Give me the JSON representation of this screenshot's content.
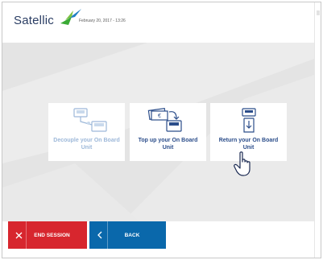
{
  "header": {
    "brand": "Satellic",
    "datetime": "February 20, 2017 - 13:26",
    "logo_icon": "satellic-logo-icon"
  },
  "options": [
    {
      "label": "Decouple your On Board Unit",
      "icon": "decouple-obu-icon",
      "state": "disabled"
    },
    {
      "label": "Top up your On Board Unit",
      "icon": "top-up-obu-icon",
      "state": "enabled"
    },
    {
      "label": "Return your On Board Unit",
      "icon": "return-obu-icon",
      "state": "enabled"
    }
  ],
  "footer": {
    "end_session": "END SESSION",
    "back": "BACK",
    "end_icon": "close-icon",
    "back_icon": "chevron-left-icon"
  },
  "colors": {
    "brand_navy": "#2a3d63",
    "brand_green": "#3aaa35",
    "brand_blue": "#1f7fc4",
    "end_red": "#d7262e",
    "back_blue": "#0a68ab",
    "enabled_text": "#2b4d8a",
    "disabled_text": "#9db8d9",
    "panel_grey": "#e6e6e6"
  }
}
